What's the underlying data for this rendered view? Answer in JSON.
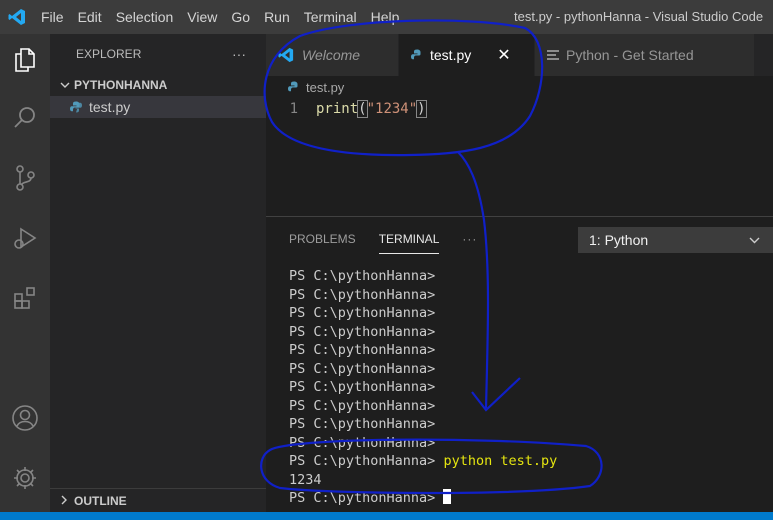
{
  "window": {
    "title": "test.py - pythonHanna - Visual Studio Code"
  },
  "menu": [
    "File",
    "Edit",
    "Selection",
    "View",
    "Go",
    "Run",
    "Terminal",
    "Help"
  ],
  "activity_icons": [
    "explorer-icon",
    "search-icon",
    "source-control-icon",
    "run-debug-icon",
    "extensions-icon",
    "account-icon",
    "settings-gear-icon"
  ],
  "sidebar": {
    "header": "EXPLORER",
    "more": "···",
    "folder": "PYTHONHANNA",
    "file": "test.py",
    "outline": "OUTLINE"
  },
  "tabs": [
    {
      "label": "Welcome",
      "icon": "vscode-icon",
      "active": false
    },
    {
      "label": "test.py",
      "icon": "python-icon",
      "active": true
    },
    {
      "label": "Python - Get Started",
      "icon": "markdown-icon",
      "active": false
    }
  ],
  "editor": {
    "breadcrumb": "test.py",
    "line_number": "1",
    "code": {
      "fn": "print",
      "open": "(",
      "str": "\"1234\"",
      "close": ")"
    }
  },
  "panel": {
    "tabs": [
      "PROBLEMS",
      "TERMINAL",
      "···"
    ],
    "active_tab": "TERMINAL",
    "terminal_select": "1: Python",
    "prompt": "PS C:\\pythonHanna>",
    "prompt_repeat_count": 10,
    "command": "python test.py",
    "output": "1234"
  },
  "colors": {
    "titlebar": "#3c3c3c",
    "activitybar": "#333333",
    "sidebar": "#252526",
    "editor": "#1e1e1e",
    "statusbar": "#007acc",
    "annotation": "#1020c8"
  }
}
